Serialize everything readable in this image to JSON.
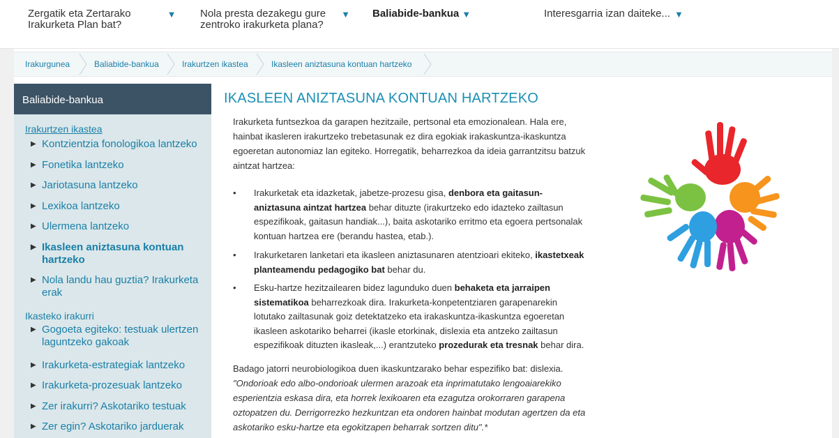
{
  "topnav": {
    "items": [
      {
        "line1": "Zergatik eta Zertarako",
        "line2": "Irakurketa Plan bat?"
      },
      {
        "line1": "Nola presta dezakegu gure",
        "line2": "zentroko irakurketa plana?"
      },
      {
        "line1": "Baliabide-bankua",
        "line2": ""
      },
      {
        "line1": "Interesgarria izan daiteke...",
        "line2": ""
      }
    ],
    "arrow": "▼"
  },
  "breadcrumb": [
    "Irakurgunea",
    "Baliabide-bankua",
    "Irakurtzen ikastea",
    "Ikasleen aniztasuna kontuan hartzeko"
  ],
  "sidebar": {
    "title": "Baliabide-bankua",
    "section1": "Irakurtzen ikastea",
    "items1": [
      "Kontzientzia fonologikoa lantzeko",
      "Fonetika lantzeko",
      "Jariotasuna lantzeko",
      "Lexikoa lantzeko",
      "Ulermena lantzeko",
      "Ikasleen aniztasuna kontuan",
      "hartzeko",
      "Nola landu hau guztia? Irakurketa",
      "erak"
    ],
    "section2": "Ikasteko irakurri",
    "items2": [
      "Gogoeta egiteko: testuak ulertzen",
      "laguntzeko gakoak",
      "Irakurketa-estrategiak lantzeko",
      "Irakurketa-prozesuak lantzeko",
      "Zer irakurri? Askotariko testuak",
      "Zer egin? Askotariko jarduerak"
    ],
    "tri": "▶"
  },
  "main": {
    "title": "IKASLEEN ANIZTASUNA KONTUAN HARTZEKO",
    "intro": [
      "Irakurketa funtsezkoa da garapen hezitzaile, pertsonal eta emozionalean. Hala ere,",
      "hainbat ikasleren irakurtzeko trebetasunak ez dira egokiak irakaskuntza-ikaskuntza",
      "egoeretan autonomiaz lan egiteko. Horregatik, beharrezkoa da ideia garrantzitsu batzuk",
      "aintzat hartzea:"
    ],
    "bullets": [
      {
        "lines": [
          {
            "pre": "Irakurketak eta idazketak, jabetze-prozesu gisa, ",
            "bold": "denbora eta gaitasun-",
            "post": ""
          },
          {
            "pre": "",
            "bold": "aniztasuna aintzat hartzea",
            "post": " behar dituzte (irakurtzeko edo idazteko zailtasun"
          },
          {
            "pre": "espezifikoak, gaitasun handiak...), baita askotariko erritmo eta egoera pertsonalak",
            "bold": "",
            "post": ""
          },
          {
            "pre": "kontuan hartzea ere (berandu hastea, etab.).",
            "bold": "",
            "post": ""
          }
        ]
      },
      {
        "lines": [
          {
            "pre": "Irakurketaren lanketari eta ikasleen aniztasunaren atentzioari ekiteko, ",
            "bold": "ikastetxeak",
            "post": ""
          },
          {
            "pre": "",
            "bold": "planteamendu pedagogiko bat",
            "post": " behar du."
          }
        ]
      },
      {
        "lines": [
          {
            "pre": "Esku-hartze hezitzailearen bidez lagunduko duen ",
            "bold": "behaketa eta jarraipen",
            "post": ""
          },
          {
            "pre": "",
            "bold": "sistematikoa",
            "post": " beharrezkoak dira. Irakurketa-konpetentziaren garapenarekin"
          },
          {
            "pre": "lotutako zailtasunak goiz detektatzeko eta irakaskuntza-ikaskuntza egoeretan",
            "bold": "",
            "post": ""
          },
          {
            "pre": "ikasleen askotariko beharrei (ikasle etorkinak, dislexia eta antzeko zailtasun",
            "bold": "",
            "post": ""
          },
          {
            "pre": "espezifikoak dituzten ikasleak,...) erantzuteko ",
            "bold": "prozedurak eta tresnak",
            "post": " behar dira."
          }
        ]
      }
    ],
    "bullet_mark": "•",
    "closing_first": "Badago jatorri neurobiologikoa duen ikaskuntzarako behar espezifiko bat: dislexia.",
    "closing_italic": [
      "\"Ondorioak edo albo-ondorioak ulermen arazoak eta inprimatutako lengoaiarekiko",
      "esperientzia eskasa dira, eta horrek lexikoaren eta ezagutza orokorraren garapena",
      "oztopatzen du. Derrigorrezko hezkuntzan eta ondoren hainbat modutan agertzen da eta",
      "askotariko esku-hartze eta egokitzapen beharrak sortzen ditu\".*"
    ]
  },
  "colors": {
    "accent": "#1a8fb5",
    "sidebar_bg": "#dbe7ea",
    "sidebar_head": "#3c5365",
    "hand_red": "#e8262b",
    "hand_orange": "#f7941d",
    "hand_magenta": "#c2208f",
    "hand_blue": "#2e9fe0",
    "hand_green": "#7cc242"
  },
  "image": {
    "icon": "colorful-hands-icon"
  }
}
